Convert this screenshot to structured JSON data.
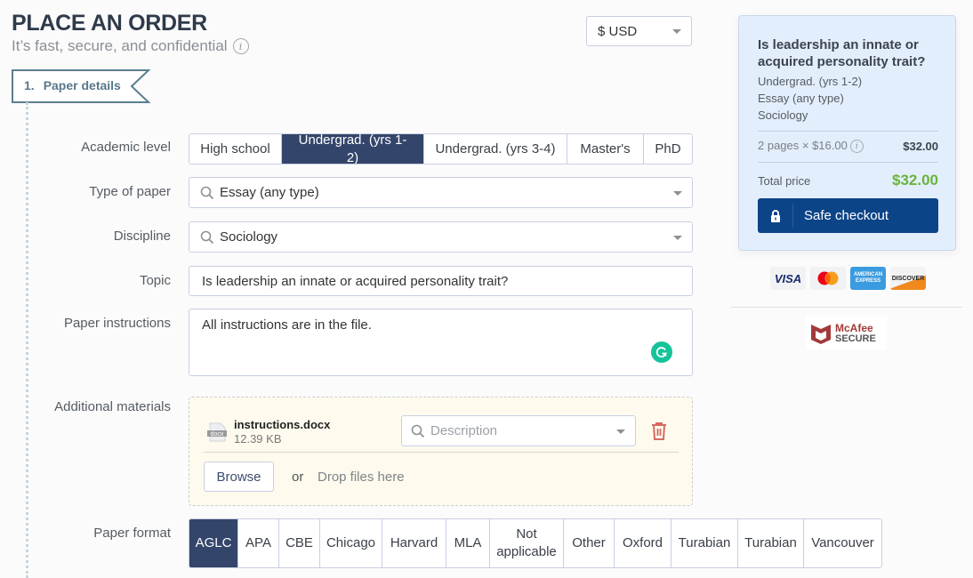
{
  "header": {
    "title": "PLACE AN ORDER",
    "subtitle": "It’s fast, secure, and confidential",
    "info_icon": "i"
  },
  "currency": {
    "selected": "$ USD"
  },
  "step": {
    "number": "1.",
    "label": "Paper details"
  },
  "form": {
    "academic_level": {
      "label": "Academic level",
      "options": [
        "High school",
        "Undergrad. (yrs 1-2)",
        "Undergrad. (yrs 3-4)",
        "Master's",
        "PhD"
      ],
      "selected": "Undergrad. (yrs 1-2)"
    },
    "type_of_paper": {
      "label": "Type of paper",
      "value": "Essay (any type)"
    },
    "discipline": {
      "label": "Discipline",
      "value": "Sociology"
    },
    "topic": {
      "label": "Topic",
      "value": "Is leadership an innate or acquired personality trait?"
    },
    "instructions": {
      "label": "Paper instructions",
      "value": "All instructions are in the file."
    },
    "additional_materials": {
      "label": "Additional materials",
      "file": {
        "icon_label": "docx",
        "name": "instructions.docx",
        "size": "12.39 KB",
        "description_placeholder": "Description"
      },
      "browse_label": "Browse",
      "or_text": "or",
      "drop_text": "Drop files here"
    },
    "paper_format": {
      "label": "Paper format",
      "options": [
        "AGLC",
        "APA",
        "CBE",
        "Chicago",
        "Harvard",
        "MLA",
        "Not applicable",
        "Other",
        "Oxford",
        "Turabian",
        "Turabian",
        "Vancouver"
      ],
      "selected": "AGLC"
    }
  },
  "summary": {
    "title": "Is leadership an innate or acquired personality trait?",
    "level": "Undergrad. (yrs 1-2)",
    "type": "Essay (any type)",
    "discipline": "Sociology",
    "pages_line": "2 pages × $16.00",
    "pages_price": "$32.00",
    "total_label": "Total price",
    "total_value": "$32.00",
    "checkout_label": "Safe checkout",
    "colors": {
      "accent": "#0c4488",
      "total": "#6bb33c",
      "selected": "#33456a"
    }
  },
  "badges": {
    "cards": [
      "VISA",
      "mastercard",
      "AMERICAN EXPRESS",
      "DISCOVER"
    ],
    "mcafee_line1": "McAfee",
    "mcafee_line2": "SECURE"
  }
}
